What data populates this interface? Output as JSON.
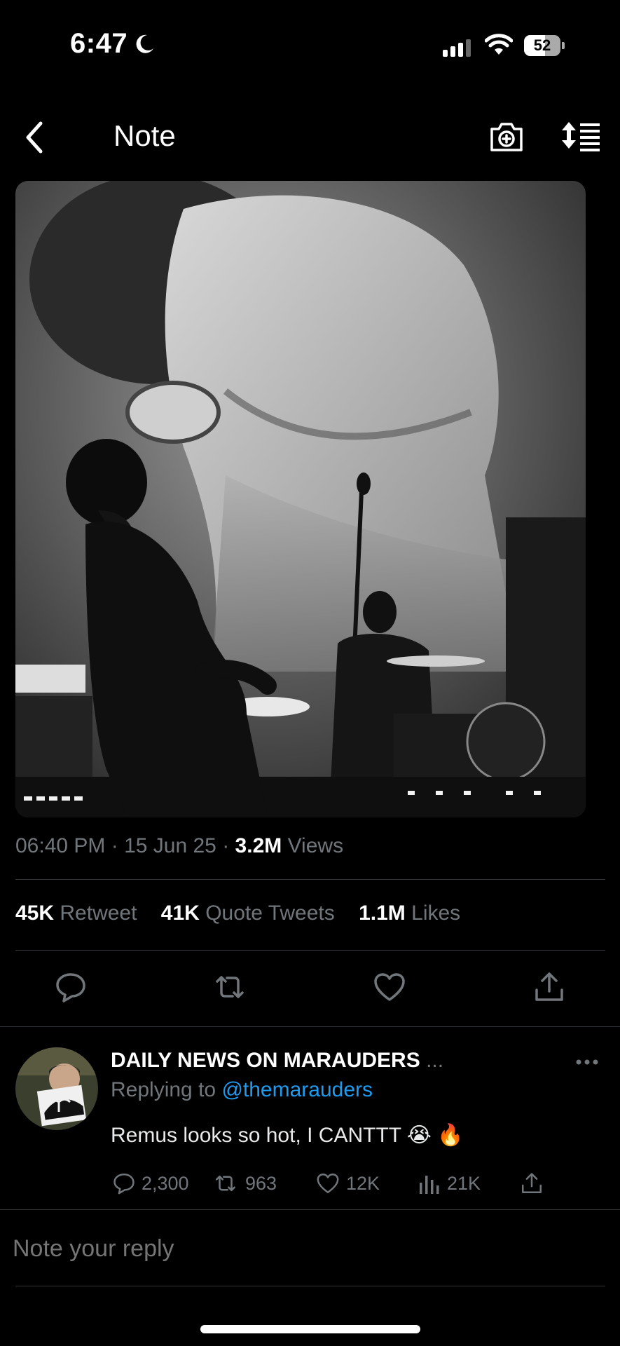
{
  "status_bar": {
    "time": "6:47",
    "battery": "52",
    "battery_level": 0.52
  },
  "nav": {
    "title": "Note",
    "icons": [
      "back-chevron-icon",
      "camera-plus-icon",
      "sort-lines-icon"
    ]
  },
  "tweet": {
    "time": "06:40 PM",
    "date": "15 Jun 25",
    "views_count": "3.2M",
    "views_label": "Views",
    "retweet_count": "45K",
    "retweet_label": "Retweet",
    "quote_count": "41K",
    "quote_label": "Quote Tweets",
    "likes_count": "1.1M",
    "likes_label": "Likes",
    "actions": [
      "reply-icon",
      "retweet-icon",
      "like-icon",
      "share-icon"
    ]
  },
  "reply": {
    "author": "DAILY NEWS ON MARAUDERS",
    "ellipsis": "...",
    "replying_prefix": "Replying to",
    "replying_handle": "@themarauders",
    "text": "Remus looks so hot, I CANTTT 😭 🔥",
    "replies": "2,300",
    "retweets": "963",
    "likes": "12K",
    "views": "21K"
  },
  "composer": {
    "placeholder": "Note your reply"
  },
  "colors": {
    "background": "#000000",
    "muted": "#71767b",
    "link": "#1d9bf0",
    "divider": "#2f3336"
  }
}
